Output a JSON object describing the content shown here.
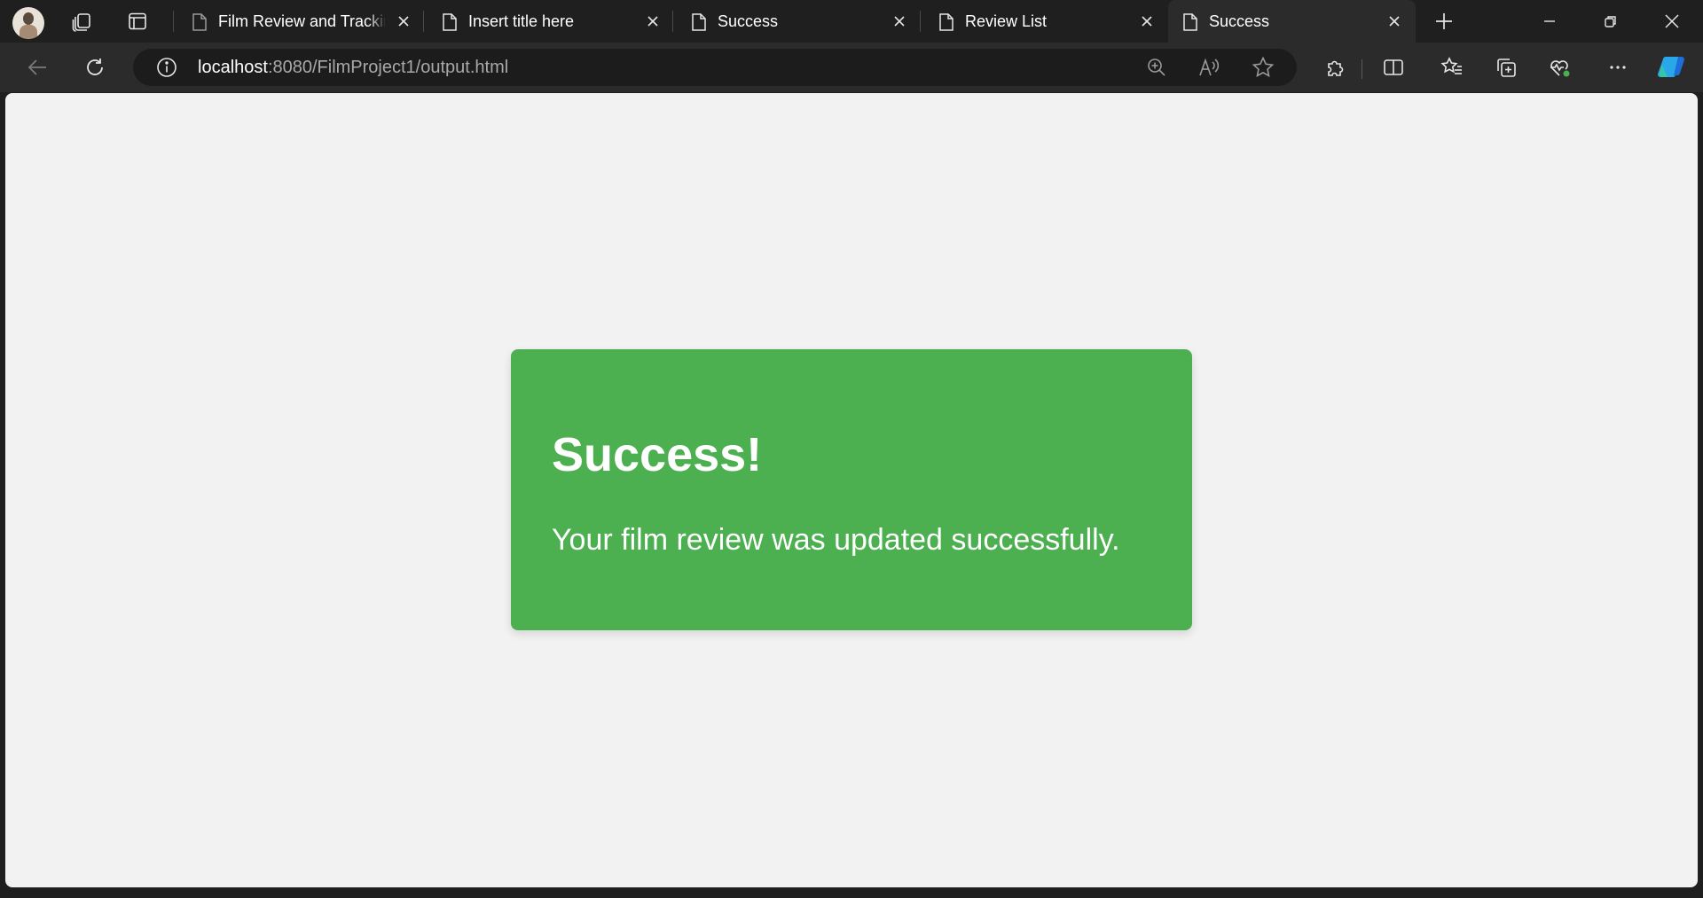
{
  "browser": {
    "tabs": [
      {
        "label": "Film Review and Tracking",
        "active": false
      },
      {
        "label": "Insert title here",
        "active": false
      },
      {
        "label": "Success",
        "active": false
      },
      {
        "label": "Review List",
        "active": false
      },
      {
        "label": "Success",
        "active": true
      }
    ],
    "address": {
      "host": "localhost",
      "rest": ":8080/FilmProject1/output.html"
    },
    "icons": {
      "profile": "profile-avatar",
      "workspaces": "workspaces-icon",
      "tab_actions": "tab-actions-icon",
      "new_tab": "plus-icon",
      "minimize": "minimize-icon",
      "restore": "restore-icon",
      "close": "close-icon",
      "back": "back-arrow-icon",
      "refresh": "refresh-icon",
      "site_info": "info-icon",
      "zoom": "zoom-in-icon",
      "read_aloud": "read-aloud-icon",
      "favorite": "star-icon",
      "extensions": "puzzle-icon",
      "split_screen": "split-screen-icon",
      "favorites": "favorites-icon",
      "collections": "collections-icon",
      "browser_essentials": "heart-pulse-icon",
      "more": "more-icon",
      "copilot": "copilot-icon"
    }
  },
  "page": {
    "title": "Success!",
    "message": "Your film review was updated successfully.",
    "colors": {
      "card_background": "#4caf50",
      "page_background": "#f2f2f2",
      "text": "#ffffff"
    }
  }
}
